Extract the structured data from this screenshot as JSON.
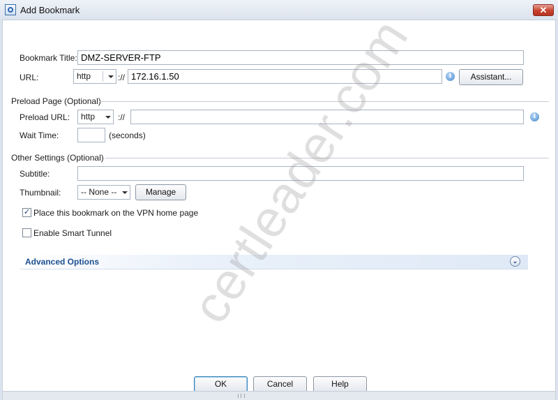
{
  "window": {
    "title": "Add Bookmark",
    "close_label": "✕"
  },
  "bookmark": {
    "title_label": "Bookmark Title:",
    "title_value": "DMZ-SERVER-FTP",
    "url_label": "URL:",
    "url_protocol": "http",
    "url_separator": "://",
    "url_value": "172.16.1.50",
    "assistant_label": "Assistant..."
  },
  "preload": {
    "section_label": "Preload Page (Optional)",
    "url_label": "Preload URL:",
    "url_protocol": "http",
    "url_separator": "://",
    "url_value": "",
    "wait_label": "Wait Time:",
    "wait_value": "",
    "wait_unit": "(seconds)"
  },
  "other": {
    "section_label": "Other Settings (Optional)",
    "subtitle_label": "Subtitle:",
    "subtitle_value": "",
    "thumbnail_label": "Thumbnail:",
    "thumbnail_value": "-- None --",
    "manage_label": "Manage",
    "place_bookmark_label": "Place this bookmark on the VPN home page",
    "place_bookmark_checked": true,
    "smart_tunnel_label": "Enable Smart Tunnel",
    "smart_tunnel_checked": false
  },
  "advanced": {
    "label": "Advanced Options"
  },
  "footer": {
    "ok_label": "OK",
    "cancel_label": "Cancel",
    "help_label": "Help"
  },
  "watermark": {
    "text": "certleader.com"
  },
  "icons": {
    "info": "info-icon",
    "chevron": "double-chevron-down-icon",
    "checkmark": "✓"
  }
}
